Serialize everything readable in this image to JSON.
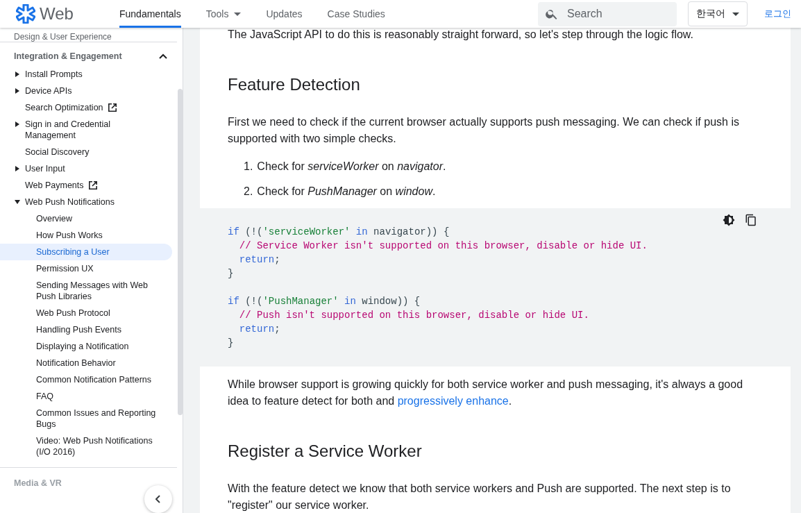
{
  "header": {
    "logo": "Web",
    "tabs": [
      {
        "label": "Fundamentals",
        "selected": true,
        "dropdown": false
      },
      {
        "label": "Tools",
        "selected": false,
        "dropdown": true
      },
      {
        "label": "Updates",
        "selected": false,
        "dropdown": false
      },
      {
        "label": "Case Studies",
        "selected": false,
        "dropdown": false
      }
    ],
    "search": {
      "placeholder": "Search"
    },
    "language": "한국어",
    "login": "로그인"
  },
  "sidebar": {
    "previous_section": "Design & User Experience",
    "section": {
      "title": "Integration & Engagement",
      "expanded": true
    },
    "items": [
      {
        "label": "Install Prompts",
        "kind": "folder",
        "expanded": false
      },
      {
        "label": "Device APIs",
        "kind": "folder",
        "expanded": false
      },
      {
        "label": "Search Optimization",
        "kind": "page",
        "external": true,
        "selected": false
      },
      {
        "label": "Sign in and Credential Management",
        "kind": "folder",
        "expanded": false
      },
      {
        "label": "Social Discovery",
        "kind": "page",
        "external": false,
        "selected": false
      },
      {
        "label": "User Input",
        "kind": "folder",
        "expanded": false
      },
      {
        "label": "Web Payments",
        "kind": "page",
        "external": true,
        "selected": false
      },
      {
        "label": "Web Push Notifications",
        "kind": "folder",
        "expanded": true,
        "children": [
          {
            "label": "Overview",
            "selected": false
          },
          {
            "label": "How Push Works",
            "selected": false
          },
          {
            "label": "Subscribing a User",
            "selected": true
          },
          {
            "label": "Permission UX",
            "selected": false
          },
          {
            "label": "Sending Messages with Web Push Libraries",
            "selected": false
          },
          {
            "label": "Web Push Protocol",
            "selected": false
          },
          {
            "label": "Handling Push Events",
            "selected": false
          },
          {
            "label": "Displaying a Notification",
            "selected": false
          },
          {
            "label": "Notification Behavior",
            "selected": false
          },
          {
            "label": "Common Notification Patterns",
            "selected": false
          },
          {
            "label": "FAQ",
            "selected": false
          },
          {
            "label": "Common Issues and Reporting Bugs",
            "selected": false
          },
          {
            "label": "Video: Web Push Notifications (I/O 2016)",
            "selected": false
          }
        ]
      }
    ],
    "next_section": "Media & VR"
  },
  "article": {
    "blocks": [
      {
        "kind": "paragraph",
        "text": "The JavaScript API to do this is reasonably straight forward, so let's step through the logic flow."
      },
      {
        "kind": "heading",
        "text": "Feature Detection"
      },
      {
        "kind": "paragraph",
        "text": "First we need to check if the current browser actually supports push messaging. We can check if push is supported with two simple checks."
      },
      {
        "kind": "list",
        "items": [
          {
            "number": "1.",
            "text": "Check for *serviceWorker* on *navigator*."
          },
          {
            "number": "2.",
            "text": "Check for *PushManager* on *window*."
          }
        ]
      },
      {
        "kind": "code",
        "groups": [
          [
            {
              "indented": false,
              "tokens": [
                {
                  "kind": "keyword",
                  "text": "if"
                },
                {
                  "kind": "plain",
                  "text": " (!("
                },
                {
                  "kind": "string",
                  "text": "'serviceWorker'"
                },
                {
                  "kind": "keyword",
                  "text": " in"
                },
                {
                  "kind": "plain",
                  "text": " navigator)) {"
                }
              ]
            },
            {
              "indented": true,
              "tokens": [
                {
                  "kind": "comment",
                  "text": "// Service Worker isn't supported on this browser, disable or hide UI."
                }
              ]
            },
            {
              "indented": true,
              "tokens": [
                {
                  "kind": "keyword",
                  "text": "return"
                },
                {
                  "kind": "plain",
                  "text": ";"
                }
              ]
            },
            {
              "indented": false,
              "tokens": [
                {
                  "kind": "plain",
                  "text": "}"
                }
              ]
            }
          ],
          [
            {
              "indented": false,
              "tokens": [
                {
                  "kind": "keyword",
                  "text": "if"
                },
                {
                  "kind": "plain",
                  "text": " (!("
                },
                {
                  "kind": "string",
                  "text": "'PushManager'"
                },
                {
                  "kind": "keyword",
                  "text": " in"
                },
                {
                  "kind": "plain",
                  "text": " window)) {"
                }
              ]
            },
            {
              "indented": true,
              "tokens": [
                {
                  "kind": "comment",
                  "text": "// Push isn't supported on this browser, disable or hide UI."
                }
              ]
            },
            {
              "indented": true,
              "tokens": [
                {
                  "kind": "keyword",
                  "text": "return"
                },
                {
                  "kind": "plain",
                  "text": ";"
                }
              ]
            },
            {
              "indented": false,
              "tokens": [
                {
                  "kind": "plain",
                  "text": "}"
                }
              ]
            }
          ]
        ]
      },
      {
        "kind": "paragraph",
        "text": "While browser support is growing quickly for both service worker and push messaging, it's always a good idea to feature detect for both and ",
        "link": "progressively enhance",
        "after": "."
      },
      {
        "kind": "heading",
        "text": "Register a Service Worker"
      },
      {
        "kind": "paragraph",
        "text": "With the feature detect we know that both service workers and Push are supported. The next step is to \"register\" our service worker."
      }
    ]
  }
}
